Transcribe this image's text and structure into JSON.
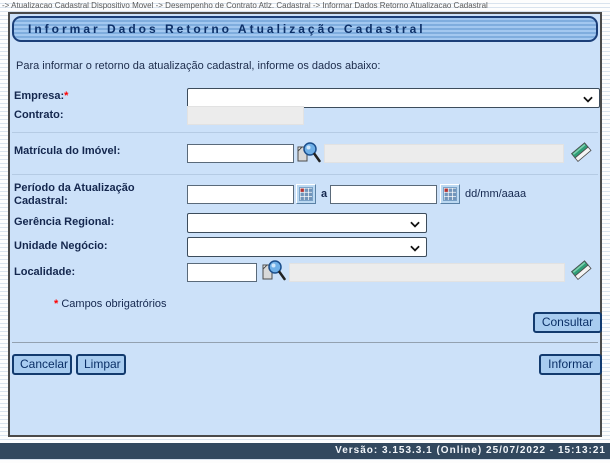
{
  "breadcrumb": {
    "text": "-> Atualizacao Cadastral Dispositivo Movel -> Desempenho de Contrato Atlz. Cadastral -> Informar Dados Retorno Atualizacao Cadastral"
  },
  "panel": {
    "title": "Informar Dados Retorno Atualização Cadastral",
    "instruction": "Para informar o retorno da atualização cadastral, informe os dados abaixo:"
  },
  "form": {
    "empresa": {
      "label": "Empresa:",
      "required_mark": "*",
      "value": ""
    },
    "contrato": {
      "label": "Contrato:",
      "value": ""
    },
    "matricula": {
      "label": "Matrícula do Imóvel:",
      "value": "",
      "descricao": ""
    },
    "periodo": {
      "label": "Período da Atualização Cadastral:",
      "from": "",
      "between": "a",
      "to": "",
      "format_hint": "dd/mm/aaaa"
    },
    "gerencia": {
      "label": "Gerência Regional:",
      "value": ""
    },
    "unidade": {
      "label": "Unidade Negócio:",
      "value": ""
    },
    "localidade": {
      "label": "Localidade:",
      "value": "",
      "descricao": ""
    },
    "required_note": {
      "mark": "*",
      "text": "Campos obrigatrórios"
    }
  },
  "buttons": {
    "consultar": "Consultar",
    "cancelar": "Cancelar",
    "limpar": "Limpar",
    "informar": "Informar"
  },
  "footer": {
    "version_text": "Versão: 3.153.3.1 (Online) 25/07/2022 - 15:13:21"
  },
  "colors": {
    "panel_bg": "#cce1f9",
    "titlebar_blue": "#7fadde",
    "title_text": "#0d3068",
    "button_bg": "#a8ccf0",
    "accent_border": "#123a6e",
    "footer_bg": "#32485e",
    "required": "#ff0000"
  }
}
